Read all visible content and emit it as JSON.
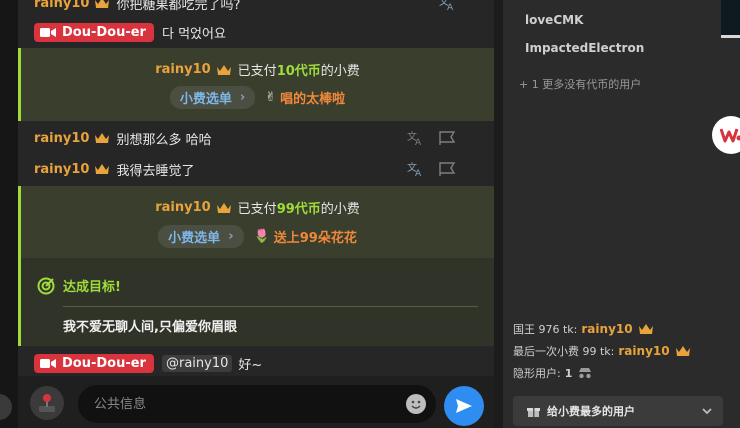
{
  "chat": {
    "top_partial": {
      "user": "rainy10",
      "text": "你把糖果都吃完了吗?"
    },
    "msg1": {
      "tag": "Dou-Dou-er",
      "text": "다 먹었어요"
    },
    "tip1": {
      "user": "rainy10",
      "paid_prefix": "已支付",
      "amount": "10代币",
      "paid_suffix": "的小费",
      "menu_label": "小费选单",
      "gift_emoji": "✌",
      "gift_text": "唱的太棒啦"
    },
    "msg2": {
      "user": "rainy10",
      "text": "别想那么多 哈哈"
    },
    "msg3": {
      "user": "rainy10",
      "text": "我得去睡觉了"
    },
    "tip2": {
      "user": "rainy10",
      "paid_prefix": "已支付",
      "amount": "99代币",
      "paid_suffix": "的小费",
      "menu_label": "小费选单",
      "gift_emoji": "🌷",
      "gift_text": "送上99朵花花"
    },
    "goal": {
      "title": "达成目标!",
      "text": "我不爱无聊人间,只偏爱你眉眼"
    },
    "msg4": {
      "tag": "Dou-Dou-er",
      "mention": "@rainy10",
      "text": "好~"
    }
  },
  "input": {
    "placeholder": "公共信息"
  },
  "right_panel": {
    "users": [
      "loveCMK",
      "ImpactedElectron"
    ],
    "more_users": "+ 1 更多没有代币的用户",
    "king_label": "国王 976 tk:",
    "king_user": "rainy10",
    "last_tip_label": "最后一次小费 99 tk:",
    "last_tip_user": "rainy10",
    "hidden_label": "隐形用户:",
    "hidden_count": "1",
    "top_tipper_button": "给小费最多的用户"
  },
  "colors": {
    "accent_green": "#9fdc3a",
    "username": "#e8a33c",
    "tag_red": "#d9343d",
    "send_blue": "#2f8cf0"
  }
}
